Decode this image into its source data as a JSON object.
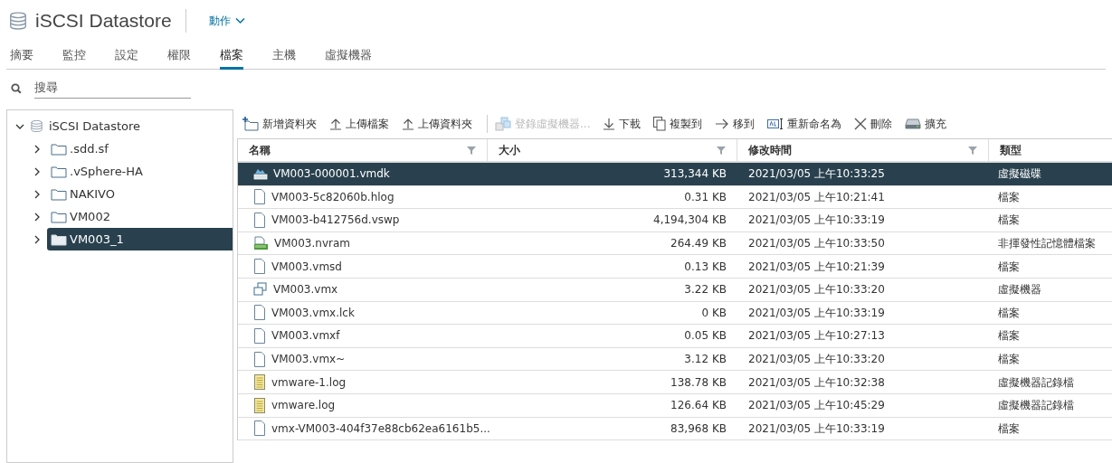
{
  "header": {
    "title": "iSCSI Datastore",
    "actions": "動作"
  },
  "tabs": [
    {
      "label": "摘要",
      "selected": false
    },
    {
      "label": "監控",
      "selected": false
    },
    {
      "label": "設定",
      "selected": false
    },
    {
      "label": "權限",
      "selected": false
    },
    {
      "label": "檔案",
      "selected": true
    },
    {
      "label": "主機",
      "selected": false
    },
    {
      "label": "虛擬機器",
      "selected": false
    }
  ],
  "search": {
    "placeholder": "搜尋"
  },
  "tree": {
    "label": "iSCSI Datastore",
    "expanded": true,
    "children": [
      {
        "label": ".sdd.sf",
        "expanded": false,
        "selected": false
      },
      {
        "label": ".vSphere-HA",
        "expanded": false,
        "selected": false
      },
      {
        "label": "NAKIVO",
        "expanded": false,
        "selected": false
      },
      {
        "label": "VM002",
        "expanded": false,
        "selected": false
      },
      {
        "label": "VM003_1",
        "expanded": false,
        "selected": true
      }
    ]
  },
  "toolbar": [
    {
      "kind": "new-folder",
      "label": "新增資料夾",
      "disabled": false
    },
    {
      "kind": "upload",
      "label": "上傳檔案",
      "disabled": false
    },
    {
      "kind": "upload",
      "label": "上傳資料夾",
      "disabled": false
    },
    {
      "kind": "register",
      "label": "登錄虛擬機器...",
      "disabled": true
    },
    {
      "kind": "download",
      "label": "下載",
      "disabled": false
    },
    {
      "kind": "copy",
      "label": "複製到",
      "disabled": false
    },
    {
      "kind": "move",
      "label": "移到",
      "disabled": false
    },
    {
      "kind": "rename",
      "label": "重新命名為",
      "disabled": false
    },
    {
      "kind": "delete",
      "label": "刪除",
      "disabled": false
    },
    {
      "kind": "inflate",
      "label": "擴充",
      "disabled": false
    }
  ],
  "table": {
    "columns": [
      "名稱",
      "大小",
      "修改時間",
      "類型"
    ],
    "rows": [
      {
        "kind": "disk",
        "name": "VM003-000001.vmdk",
        "size": "313,344 KB",
        "modified": "2021/03/05 上午10:33:25",
        "type": "虛擬磁碟",
        "selected": true
      },
      {
        "kind": "file",
        "name": "VM003-5c82060b.hlog",
        "size": "0.31 KB",
        "modified": "2021/03/05 上午10:21:41",
        "type": "檔案",
        "selected": false
      },
      {
        "kind": "file",
        "name": "VM003-b412756d.vswp",
        "size": "4,194,304 KB",
        "modified": "2021/03/05 上午10:33:19",
        "type": "檔案",
        "selected": false
      },
      {
        "kind": "memory",
        "name": "VM003.nvram",
        "size": "264.49 KB",
        "modified": "2021/03/05 上午10:33:50",
        "type": "非揮發性記憶體檔案",
        "selected": false
      },
      {
        "kind": "file",
        "name": "VM003.vmsd",
        "size": "0.13 KB",
        "modified": "2021/03/05 上午10:21:39",
        "type": "檔案",
        "selected": false
      },
      {
        "kind": "vm",
        "name": "VM003.vmx",
        "size": "3.22 KB",
        "modified": "2021/03/05 上午10:33:20",
        "type": "虛擬機器",
        "selected": false
      },
      {
        "kind": "file",
        "name": "VM003.vmx.lck",
        "size": "0 KB",
        "modified": "2021/03/05 上午10:33:19",
        "type": "檔案",
        "selected": false
      },
      {
        "kind": "file",
        "name": "VM003.vmxf",
        "size": "0.05 KB",
        "modified": "2021/03/05 上午10:27:13",
        "type": "檔案",
        "selected": false
      },
      {
        "kind": "file",
        "name": "VM003.vmx~",
        "size": "3.12 KB",
        "modified": "2021/03/05 上午10:33:20",
        "type": "檔案",
        "selected": false
      },
      {
        "kind": "log",
        "name": "vmware-1.log",
        "size": "138.78 KB",
        "modified": "2021/03/05 上午10:32:38",
        "type": "虛擬機器記錄檔",
        "selected": false
      },
      {
        "kind": "log",
        "name": "vmware.log",
        "size": "126.64 KB",
        "modified": "2021/03/05 上午10:45:29",
        "type": "虛擬機器記錄檔",
        "selected": false
      },
      {
        "kind": "file",
        "name": "vmx-VM003-404f37e88cb62ea6161b5...",
        "size": "83,968 KB",
        "modified": "2021/03/05 上午10:33:19",
        "type": "檔案",
        "selected": false
      }
    ]
  }
}
